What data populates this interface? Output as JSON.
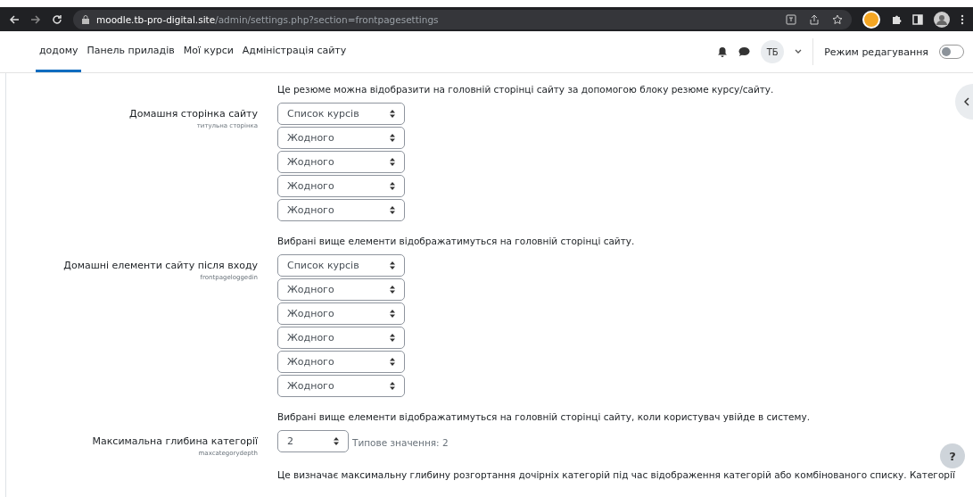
{
  "browser": {
    "url_host": "moodle.tb-pro-digital.site",
    "url_path": "/admin/settings.php?section=frontpagesettings"
  },
  "nav": {
    "tabs": [
      {
        "label": "додому",
        "selected": true
      },
      {
        "label": "Панель приладів",
        "selected": false
      },
      {
        "label": "Мої курси",
        "selected": false
      },
      {
        "label": "Адміністрація сайту",
        "selected": false
      }
    ],
    "avatar": "ТБ",
    "edit_mode": {
      "label": "Режим редагування",
      "on": false
    }
  },
  "blocks": [
    {
      "kind": "description",
      "text": "Це резюме можна відобразити на головній сторінці сайту за допомогою блоку резюме курсу/сайту."
    },
    {
      "kind": "setting",
      "label": "Домашня сторінка сайту",
      "key": "титульна сторінка",
      "selects": [
        "Список курсів",
        "Жодного",
        "Жодного",
        "Жодного",
        "Жодного"
      ]
    },
    {
      "kind": "description",
      "text": "Вибрані вище елементи відображатимуться на головній сторінці сайту."
    },
    {
      "kind": "setting",
      "label": "Домашні елементи сайту після входу",
      "key": "frontpageloggedin",
      "selects": [
        "Список курсів",
        "Жодного",
        "Жодного",
        "Жодного",
        "Жодного",
        "Жодного"
      ]
    },
    {
      "kind": "description",
      "text": "Вибрані вище елементи відображатимуться на головній сторінці сайту, коли користувач увійде в систему."
    },
    {
      "kind": "setting",
      "label": "Максимальна глибина категорії",
      "key": "maxcategorydepth",
      "selects": [
        "2"
      ],
      "default_note": "Типове значення: 2"
    },
    {
      "kind": "description",
      "text": "Це визначає максимальну глибину розгортання дочірніх категорій під час відображення категорій або комбінованого списку. Категорії"
    }
  ],
  "help_button": "?"
}
